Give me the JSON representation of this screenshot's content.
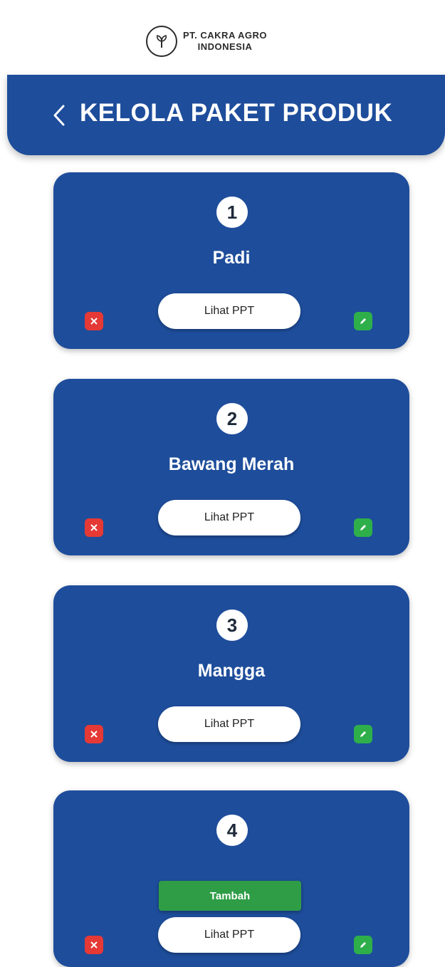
{
  "brand": {
    "line1": "PT. CAKRA AGRO",
    "line2": "INDONESIA",
    "logo_icon": "leaf-emblem-icon"
  },
  "header": {
    "title": "KELOLA PAKET PRODUK",
    "back_icon": "chevron-left-icon",
    "color": "#1e4d9b"
  },
  "cards": [
    {
      "number": "1",
      "name": "Padi",
      "button_label": "Lihat PPT"
    },
    {
      "number": "2",
      "name": "Bawang Merah",
      "button_label": "Lihat PPT"
    },
    {
      "number": "3",
      "name": "Mangga",
      "button_label": "Lihat PPT"
    },
    {
      "number": "4",
      "name": "",
      "button_label": "Lihat PPT"
    }
  ],
  "toast": {
    "text": "Tambah",
    "color": "#2e9d46"
  },
  "colors": {
    "delete": "#e53935",
    "edit": "#2eaf4a",
    "card": "#1e4d9b"
  }
}
